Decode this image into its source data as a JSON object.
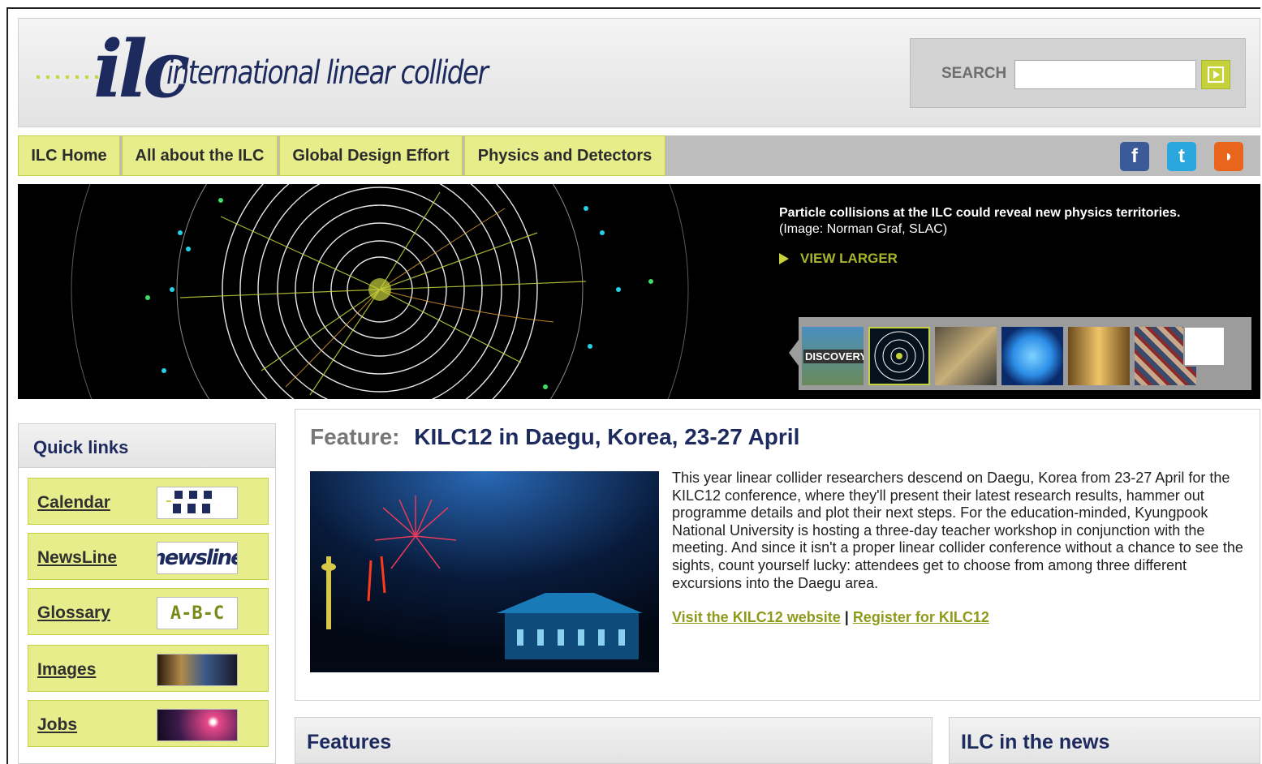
{
  "header": {
    "logo_mark": "ilc",
    "logo_text": "international linear collider",
    "search_label": "SEARCH",
    "search_value": "",
    "search_go_icon": "play-arrow-icon"
  },
  "nav": {
    "items": [
      {
        "label": "ILC Home"
      },
      {
        "label": "All about the ILC"
      },
      {
        "label": "Global Design Effort"
      },
      {
        "label": "Physics and Detectors"
      }
    ],
    "social": [
      {
        "icon": "facebook-icon",
        "glyph": "f",
        "color": "#3a5a98"
      },
      {
        "icon": "twitter-icon",
        "glyph": "t",
        "color": "#2ca7dd"
      },
      {
        "icon": "rss-icon",
        "glyph": "◗",
        "color": "#e8651b"
      }
    ]
  },
  "hero": {
    "caption_bold": "Particle collisions at the ILC could reveal new physics territories.",
    "caption_credit": "(Image: Norman Graf, SLAC)",
    "view_larger": "VIEW LARGER",
    "thumbs": [
      {
        "label": "DISCOVERY"
      },
      {
        "label": ""
      },
      {
        "label": ""
      },
      {
        "label": ""
      },
      {
        "label": ""
      },
      {
        "label": ""
      }
    ]
  },
  "quick_links": {
    "title": "Quick links",
    "items": [
      {
        "label": "Calendar",
        "icon_text": ""
      },
      {
        "label": "NewsLine",
        "icon_text": "newsline"
      },
      {
        "label": "Glossary",
        "icon_text": "A-B-C"
      },
      {
        "label": "Images",
        "icon_text": ""
      },
      {
        "label": "Jobs",
        "icon_text": ""
      }
    ]
  },
  "feature": {
    "prefix": "Feature:",
    "title": "KILC12 in Daegu, Korea, 23-27 April",
    "body": "This year linear collider researchers descend on Daegu, Korea from 23-27 April for the KILC12 conference, where they'll present their latest research results, hammer out programme details and plot their next steps. For the education-minded, Kyungpook National University is hosting a three-day teacher workshop in conjunction with the meeting. And since it isn't a proper linear collider conference without a chance to see the sights, count yourself lucky: attendees get to choose from among three different excursions into the Daegu area.",
    "link1": "Visit the KILC12 website",
    "separator": "|",
    "link2": "Register for KILC12"
  },
  "bottom": {
    "features_title": "Features",
    "news_title": "ILC in the news"
  },
  "colors": {
    "brand_navy": "#1c2a5e",
    "accent_lime": "#c6d23c",
    "nav_bg": "#e6ed8a"
  }
}
